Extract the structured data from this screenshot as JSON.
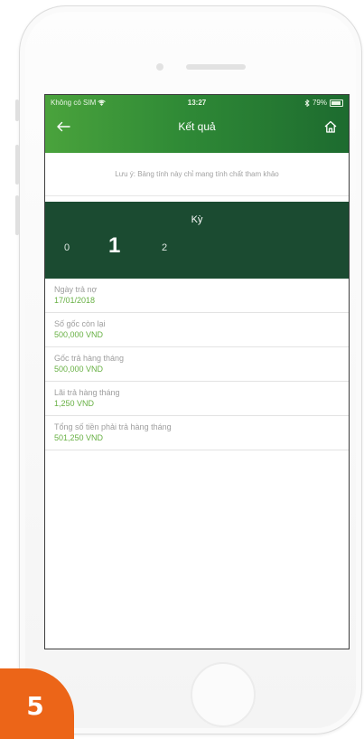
{
  "status_bar": {
    "carrier": "Không có SIM",
    "time": "13:27",
    "battery": "79%",
    "battery_level": 0.79
  },
  "header": {
    "title": "Kết quả",
    "back_icon": "arrow-left-icon",
    "home_icon": "home-icon"
  },
  "note": "Lưu ý: Bảng tính này chỉ mang tính chất tham khảo",
  "period": {
    "title": "Kỳ",
    "tabs": [
      "0",
      "1",
      "2"
    ],
    "selected": "1"
  },
  "results": [
    {
      "label": "Ngày trả nợ",
      "value": "17/01/2018"
    },
    {
      "label": "Số gốc còn lại",
      "value": "500,000 VND"
    },
    {
      "label": "Gốc trả hàng tháng",
      "value": "500,000 VND"
    },
    {
      "label": "Lãi trả hàng tháng",
      "value": "1,250 VND"
    },
    {
      "label": "Tổng số tiền phải trả hàng tháng",
      "value": "501,250 VND"
    }
  ],
  "step_badge": "5",
  "colors": {
    "header_start": "#4aa33c",
    "header_end": "#1d6b2f",
    "panel": "#1b4b31",
    "value_green": "#67b043",
    "badge_orange": "#ec6518"
  }
}
